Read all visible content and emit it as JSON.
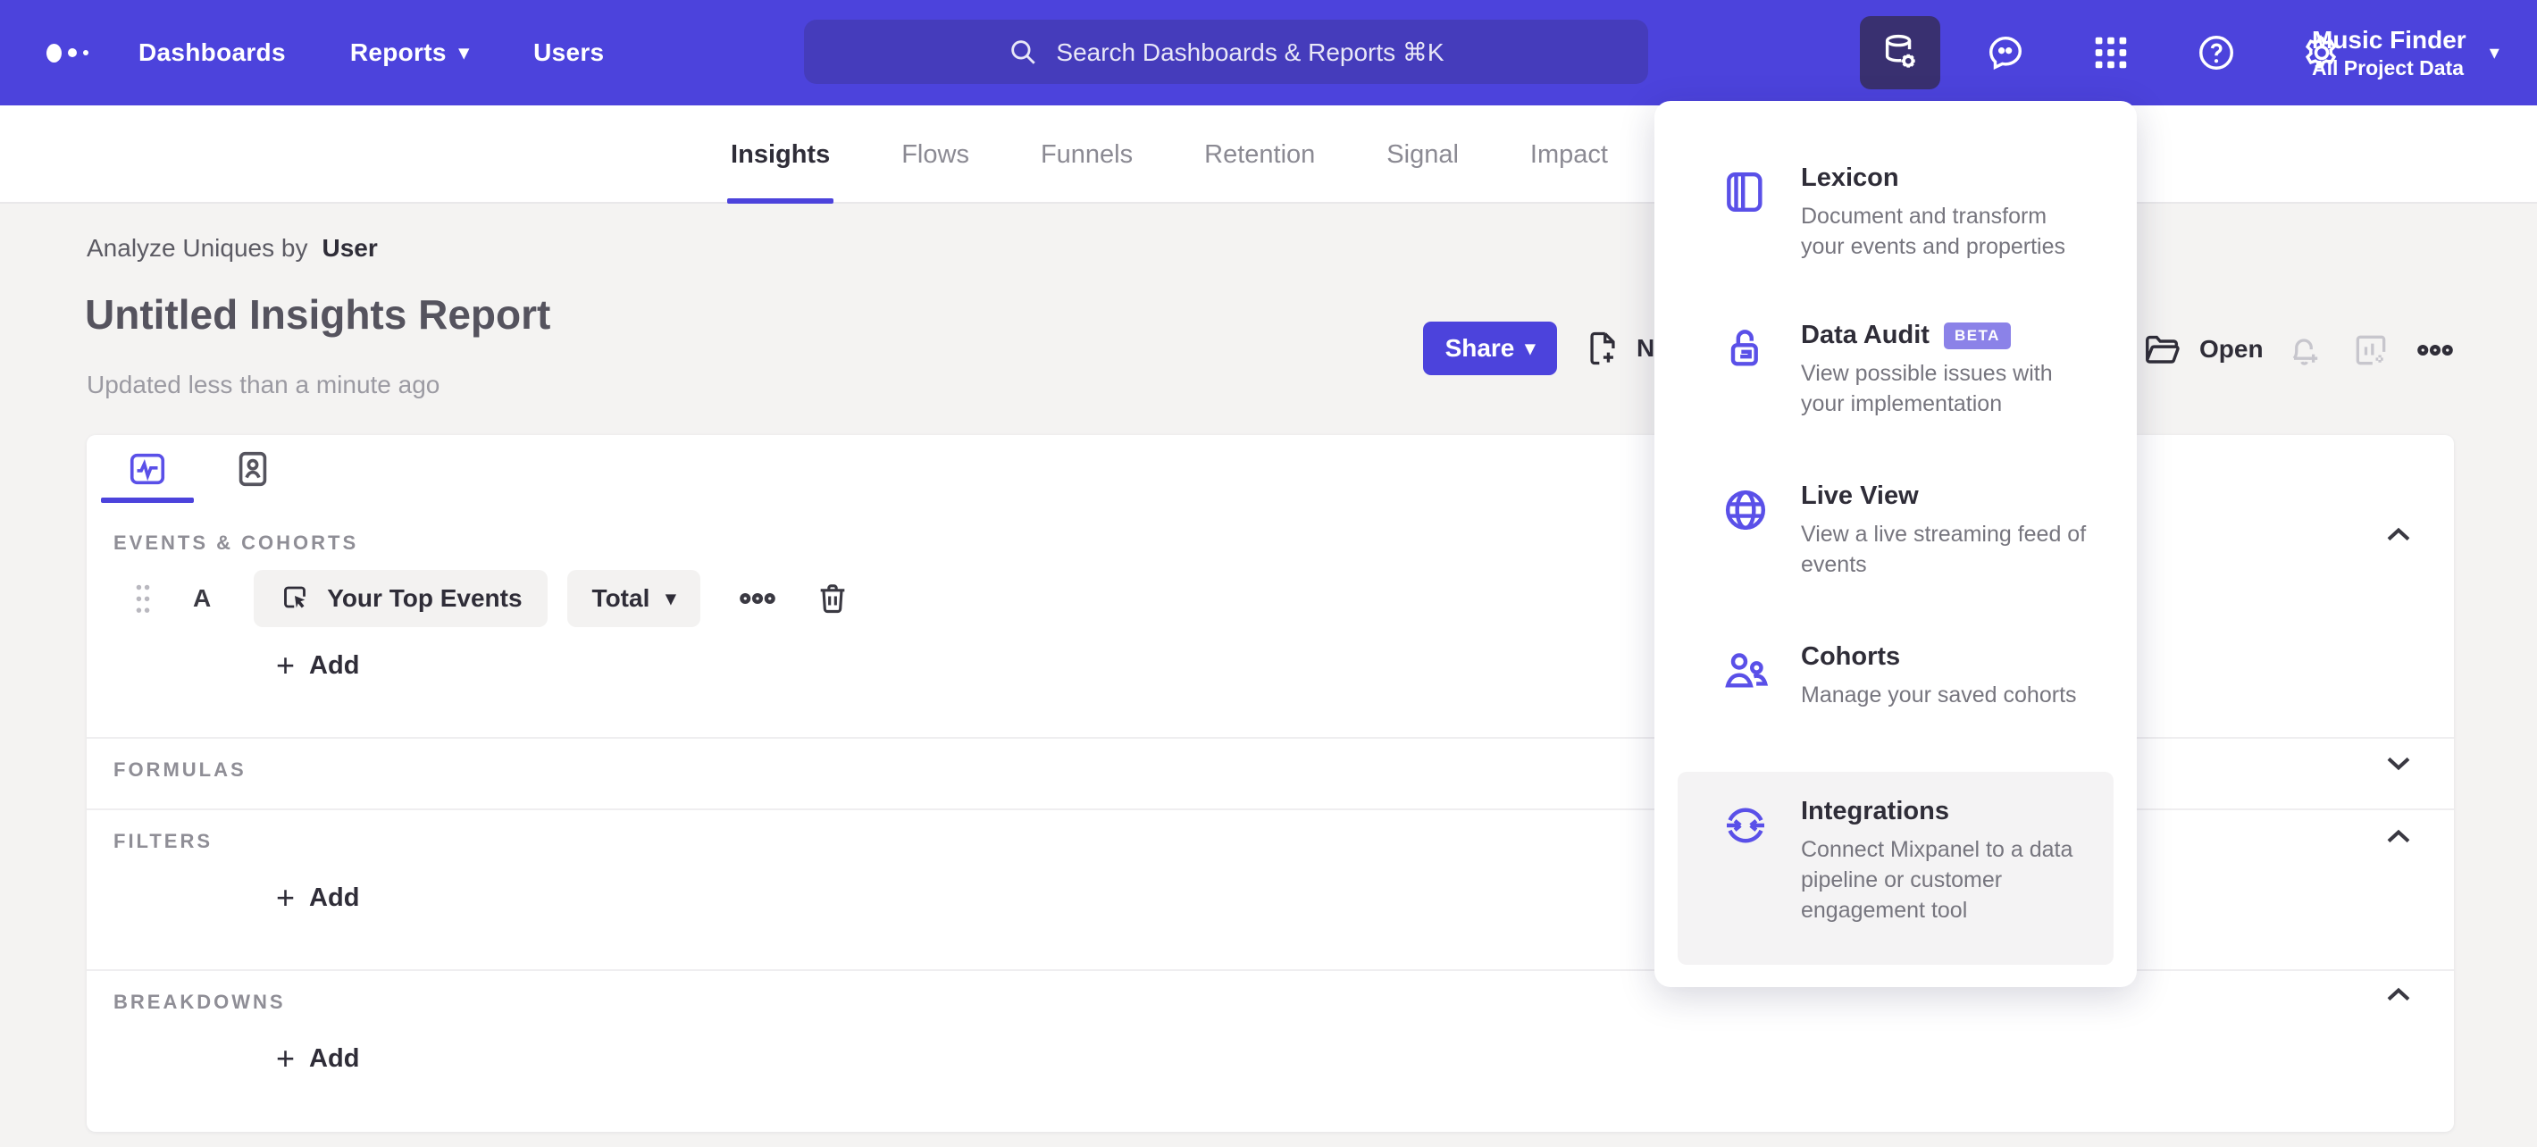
{
  "colors": {
    "accent": "#4C43DC",
    "search_bg": "#453CBB",
    "active_tile_bg": "#393070",
    "beta_badge": "#8B82E8",
    "menu_icon": "#5A50E8",
    "body_bg": "#F4F3F2"
  },
  "header": {
    "nav": [
      {
        "label": "Dashboards"
      },
      {
        "label": "Reports",
        "caret": "▾"
      },
      {
        "label": "Users"
      }
    ],
    "search_placeholder": "Search Dashboards & Reports ⌘K",
    "project": {
      "name": "Music Finder",
      "scope": "All Project Data",
      "caret": "▾"
    }
  },
  "report_tabs": {
    "active": "Insights",
    "items": [
      {
        "label": "Insights"
      },
      {
        "label": "Flows"
      },
      {
        "label": "Funnels"
      },
      {
        "label": "Retention"
      },
      {
        "label": "Signal"
      },
      {
        "label": "Impact"
      }
    ]
  },
  "page": {
    "analyze_prefix": "Analyze Uniques by",
    "analyze_value": "User",
    "title": "Untitled Insights Report",
    "updated": "Updated less than a minute ago"
  },
  "actions": {
    "share": "Share",
    "share_caret": "▾",
    "new": "New",
    "open": "Open"
  },
  "builder": {
    "events": {
      "label": "EVENTS & COHORTS",
      "series_letter": "A",
      "event_name": "Your Top Events",
      "metric": "Total",
      "metric_caret": "▾",
      "add_label": "Add",
      "add_plus": "+"
    },
    "formulas": {
      "label": "FORMULAS"
    },
    "filters": {
      "label": "FILTERS",
      "add_label": "Add",
      "add_plus": "+"
    },
    "breakdowns": {
      "label": "BREAKDOWNS",
      "add_label": "Add",
      "add_plus": "+"
    }
  },
  "data_menu": {
    "items": [
      {
        "title": "Lexicon",
        "description": "Document and transform your events and properties"
      },
      {
        "title": "Data Audit",
        "badge": "BETA",
        "description": "View possible issues with your implementation"
      },
      {
        "title": "Live View",
        "description": "View a live streaming feed of events"
      },
      {
        "title": "Cohorts",
        "description": "Manage your saved cohorts"
      },
      {
        "title": "Integrations",
        "description": "Connect Mixpanel to a data pipeline or customer engagement tool"
      }
    ]
  }
}
